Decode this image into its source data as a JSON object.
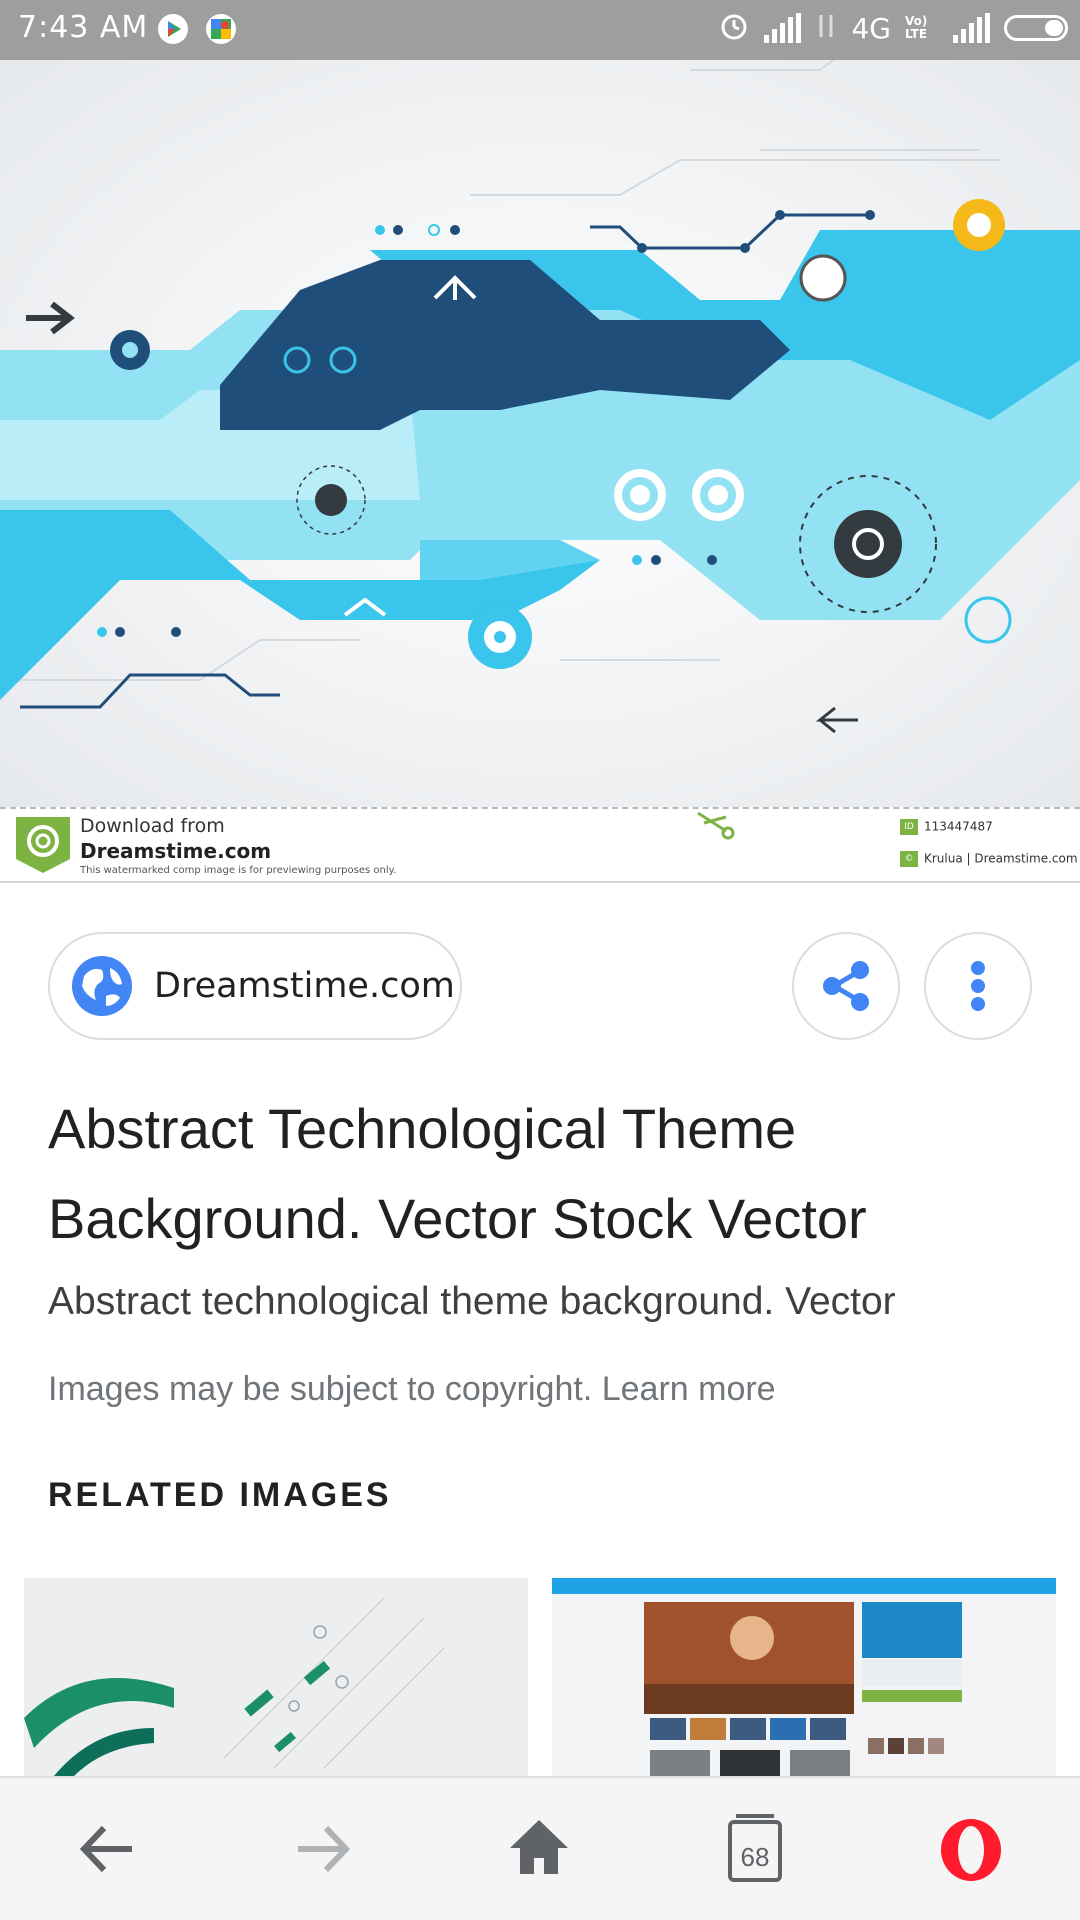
{
  "status_bar": {
    "time": "7:43 AM",
    "network": "4G",
    "volte": "Vo) LTE",
    "icons": [
      "play-store-icon",
      "maps-icon",
      "alarm-icon",
      "signal-icon",
      "data-arrows-icon",
      "battery-icon"
    ]
  },
  "watermark": {
    "download_from": "Download from",
    "site": "Dreamstime.com",
    "note": "This watermarked comp image is for previewing purposes only.",
    "id_label": "ID",
    "id": "113447487",
    "credit": "Krulua | Dreamstime.com"
  },
  "source": {
    "label": "Dreamstime.com"
  },
  "result": {
    "title": "Abstract Technological Theme Background. Vector Stock Vector",
    "description": "Abstract technological theme background. Vector",
    "copyright": "Images may be subject to copyright. Learn more"
  },
  "related": {
    "heading": "RELATED IMAGES"
  },
  "bottom_nav": {
    "tab_count": "68"
  },
  "colors": {
    "accent_blue": "#4285f4",
    "opera_red": "#ff1b2d",
    "light_cyan": "#93e2f4",
    "cyan": "#39c5ec",
    "navy": "#1f4e7a"
  }
}
